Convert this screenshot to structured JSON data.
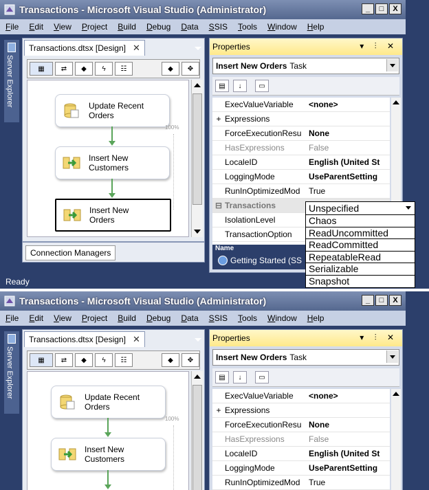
{
  "window_title": "Transactions - Microsoft Visual Studio (Administrator)",
  "window_buttons": [
    "_",
    "□",
    "X"
  ],
  "menu": [
    "File",
    "Edit",
    "View",
    "Project",
    "Build",
    "Debug",
    "Data",
    "SSIS",
    "Tools",
    "Window",
    "Help"
  ],
  "sidebar": {
    "label": "Server Explorer"
  },
  "designer": {
    "tab_title": "Transactions.dtsx [Design]",
    "close_glyph": "✕",
    "zoom_label": "100%",
    "tasks": [
      {
        "label": "Update Recent Orders"
      },
      {
        "label": "Insert New Customers"
      },
      {
        "label": "Insert New Orders"
      }
    ]
  },
  "connection_managers": {
    "label": "Connection Managers"
  },
  "properties": {
    "header": "Properties",
    "header_controls": "▾ ⫶ ✕",
    "object_bold": "Insert New Orders",
    "object_type": "Task",
    "rows": [
      {
        "name": "ExecValueVariable",
        "value": "<none>",
        "bold": true
      },
      {
        "name": "Expressions",
        "value": "",
        "expander": "+"
      },
      {
        "name": "ForceExecutionResu",
        "value": "None",
        "bold": true
      },
      {
        "name": "HasExpressions",
        "value": "False",
        "dim": true
      },
      {
        "name": "LocaleID",
        "value": "English (United St",
        "bold": true
      },
      {
        "name": "LoggingMode",
        "value": "UseParentSetting",
        "bold": true
      },
      {
        "name": "RunInOptimizedMod",
        "value": "True"
      }
    ],
    "category": "Transactions",
    "transaction_rows": [
      {
        "name": "IsolationLevel",
        "value": ""
      },
      {
        "name": "TransactionOption",
        "value": ""
      }
    ],
    "desc_name": "Name",
    "getting_started": "Getting Started (SS"
  },
  "status": "Ready",
  "dropdown": {
    "selected": "Unspecified",
    "options": [
      "Chaos",
      "ReadUncommitted",
      "ReadCommitted",
      "RepeatableRead",
      "Serializable",
      "Snapshot"
    ]
  },
  "colors": {
    "connector": "#5aa55a",
    "titlebar": "#55688f",
    "properties_header": "#ffe98a"
  }
}
